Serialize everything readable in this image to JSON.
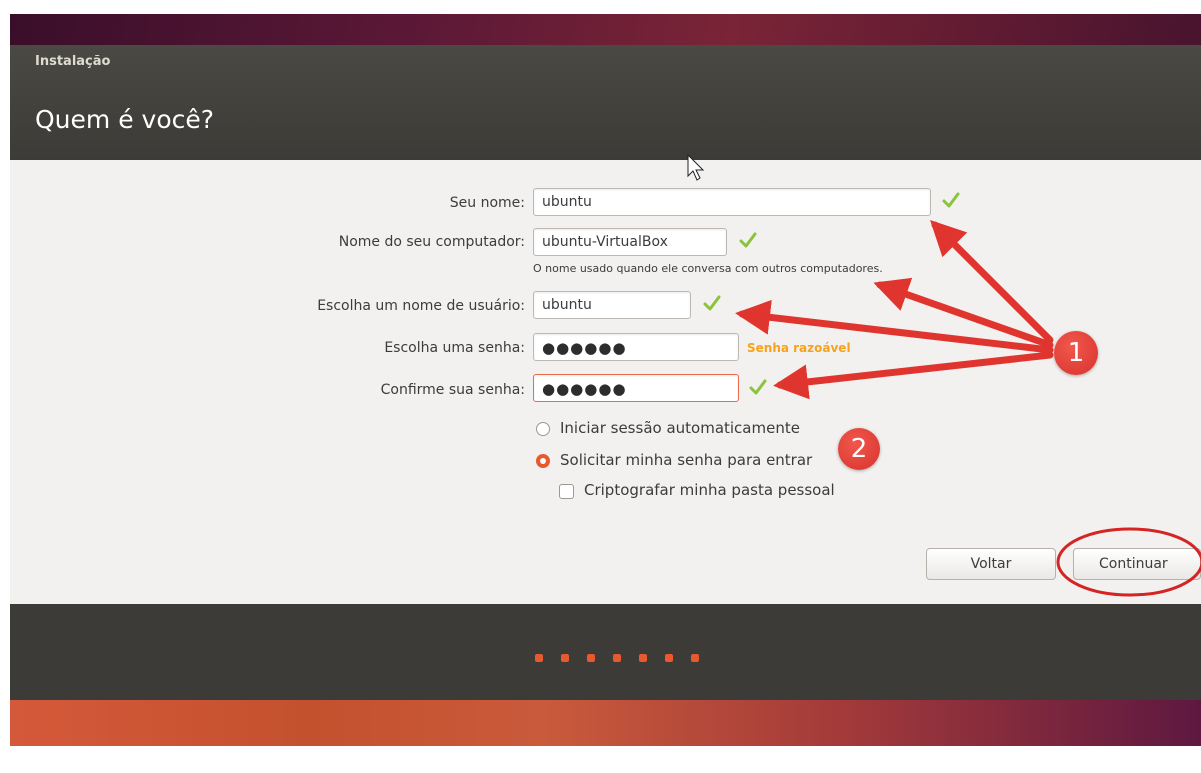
{
  "window": {
    "title": "Instalação",
    "page_title": "Quem é você?"
  },
  "form": {
    "name_label": "Seu nome:",
    "name_value": "ubuntu",
    "computer_label": "Nome do seu computador:",
    "computer_value": "ubuntu-VirtualBox",
    "computer_hint": "O nome usado quando ele conversa com outros computadores.",
    "username_label": "Escolha um nome de usuário:",
    "username_value": "ubuntu",
    "password_label": "Escolha uma senha:",
    "password_value": "●●●●●●",
    "password_strength": "Senha razoável",
    "confirm_label": "Confirme sua senha:",
    "confirm_value": "●●●●●●"
  },
  "options": {
    "auto_login": "Iniciar sessão automaticamente",
    "auto_login_selected": false,
    "require_password": "Solicitar minha senha para entrar",
    "require_password_selected": true,
    "encrypt_home": "Criptografar minha pasta pessoal",
    "encrypt_home_checked": false
  },
  "buttons": {
    "back": "Voltar",
    "continue": "Continuar"
  },
  "progress": {
    "steps": 7
  },
  "annotations": {
    "badge_1": "1",
    "badge_2": "2"
  },
  "colors": {
    "accent": "#e9592e",
    "check": "#8ac43a",
    "strength": "#f7a21b",
    "annotation_red": "#e0352e"
  },
  "icons": {
    "check": "check-icon",
    "pointer": "mouse-pointer-icon"
  }
}
